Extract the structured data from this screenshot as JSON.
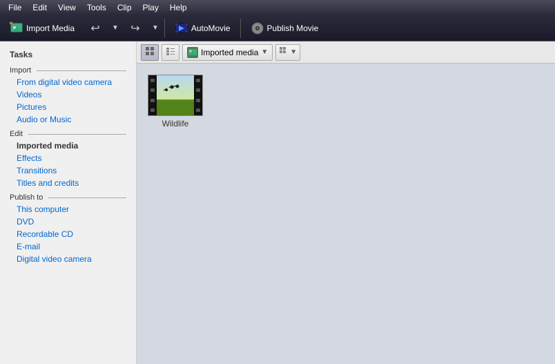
{
  "menubar": {
    "items": [
      "File",
      "Edit",
      "View",
      "Tools",
      "Clip",
      "Play",
      "Help"
    ]
  },
  "toolbar": {
    "import_label": "Import Media",
    "undo_arrow": "▼",
    "redo_arrow": "▼",
    "automovie_label": "AutoMovie",
    "publish_label": "Publish Movie"
  },
  "sidebar": {
    "tasks_label": "Tasks",
    "import_section": "Import",
    "import_links": [
      "From digital video camera",
      "Videos",
      "Pictures",
      "Audio or Music"
    ],
    "edit_section": "Edit",
    "edit_links": [
      "Imported media",
      "Effects",
      "Transitions",
      "Titles and credits"
    ],
    "publish_section": "Publish to",
    "publish_links": [
      "This computer",
      "DVD",
      "Recordable CD",
      "E-mail",
      "Digital video camera"
    ]
  },
  "content": {
    "view_grid_icon": "▦",
    "view_detail_icon": "☰",
    "dropdown_label": "Imported media",
    "dropdown_icon": "🎬",
    "view_options_icon": "▦",
    "view_options_arrow": "▼",
    "media_items": [
      {
        "label": "Wildlife",
        "type": "video"
      }
    ]
  }
}
